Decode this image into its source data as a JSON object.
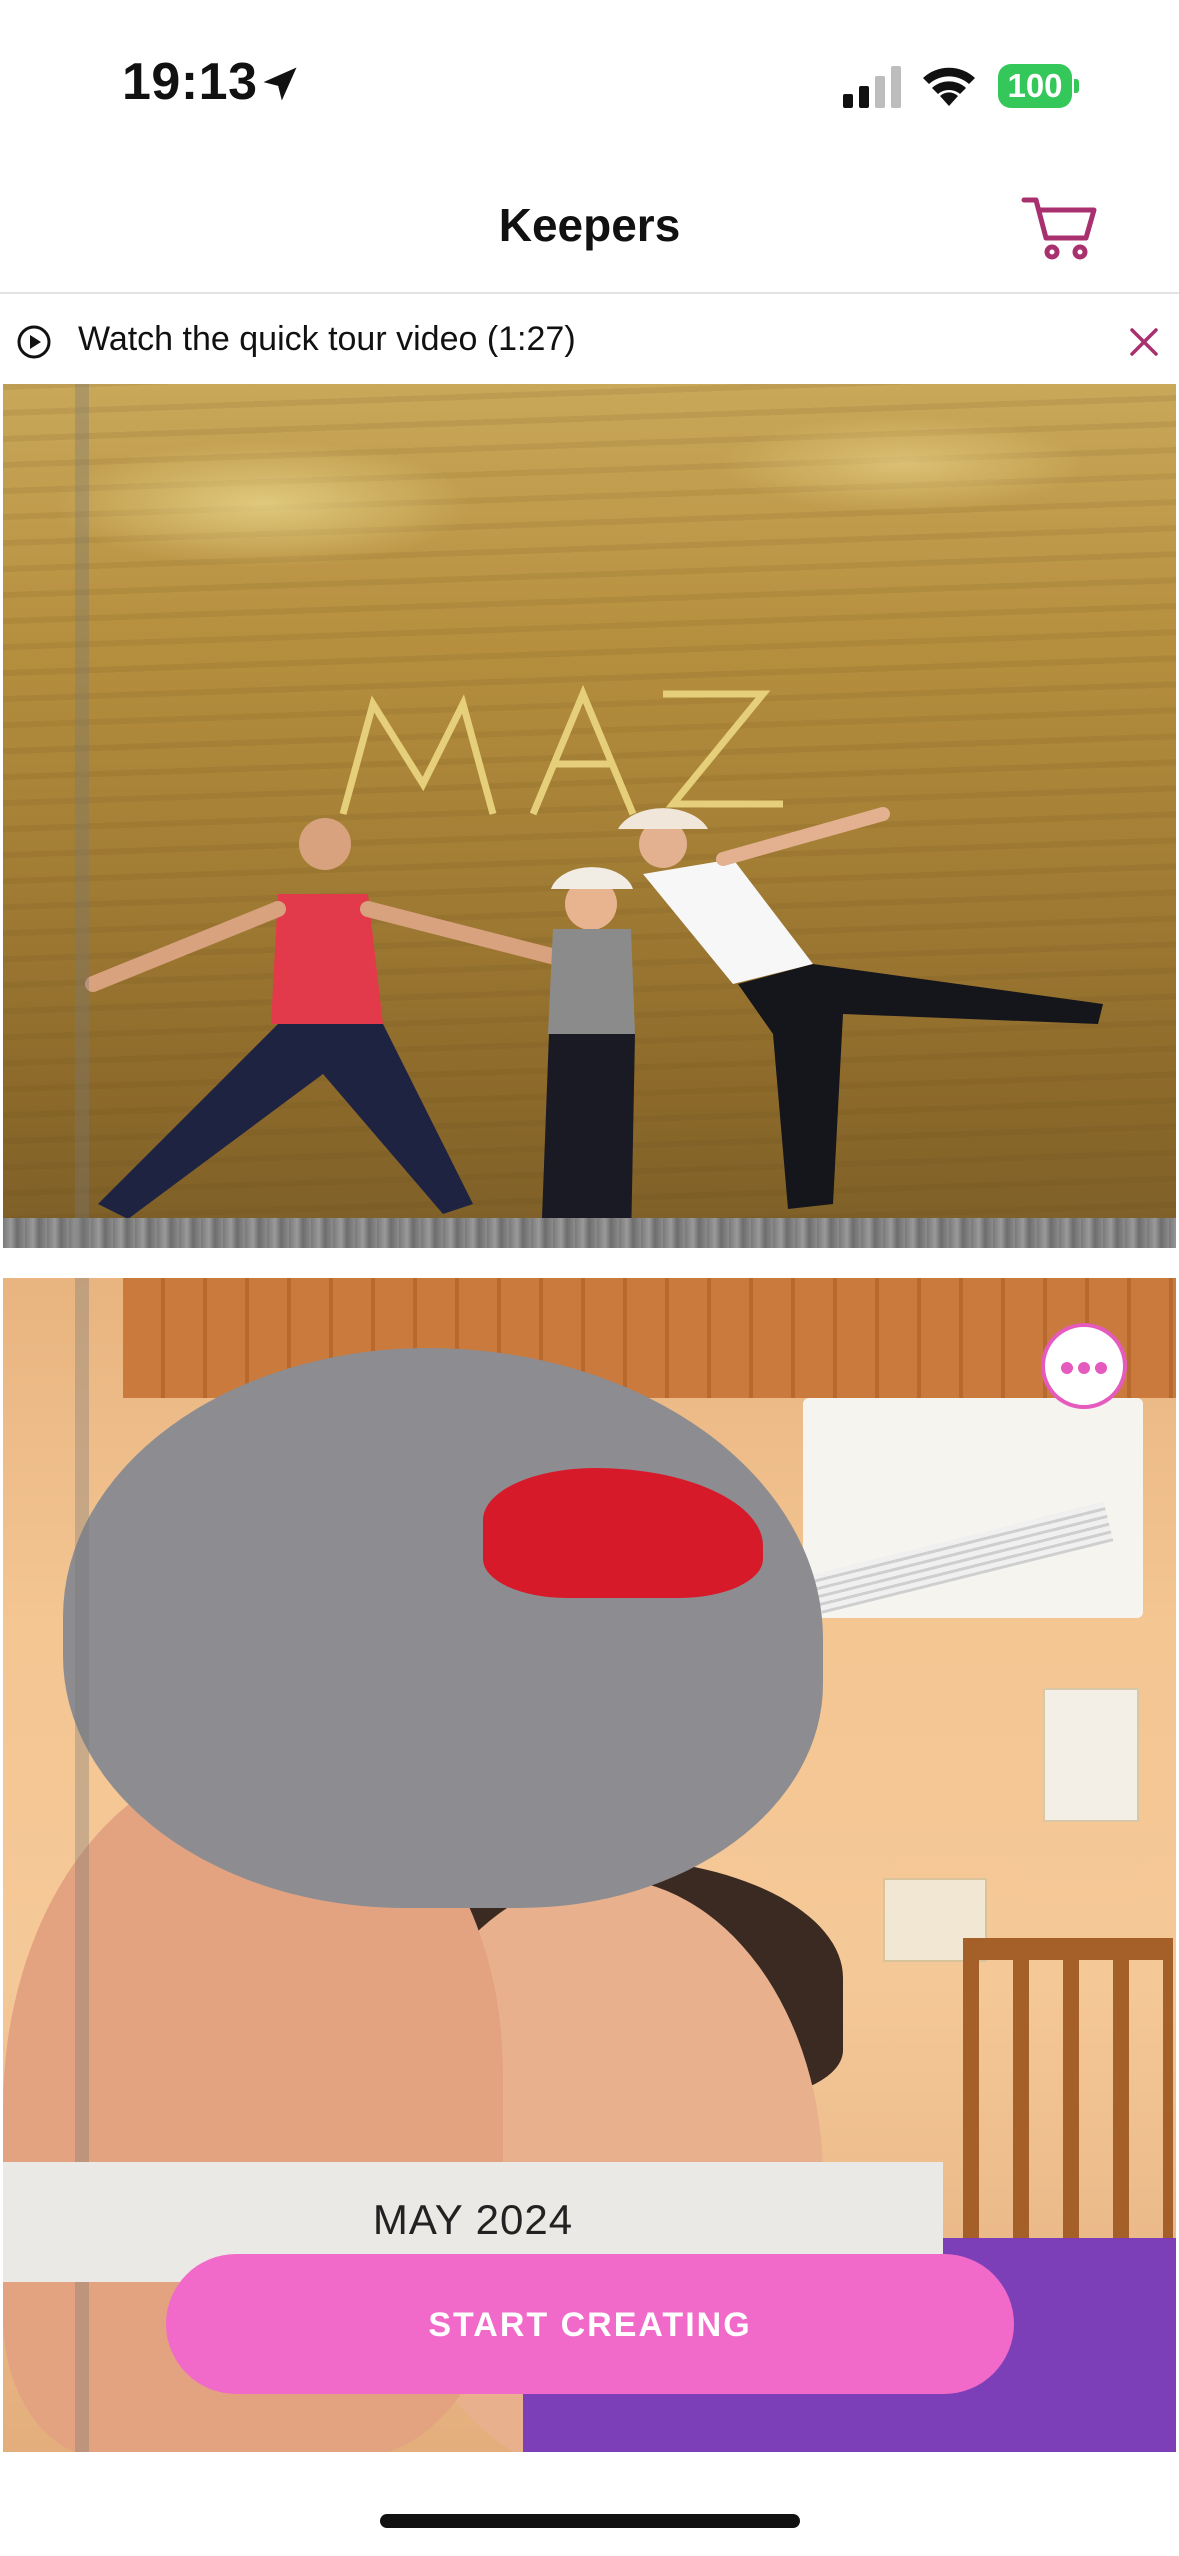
{
  "status_bar": {
    "time": "19:13",
    "battery": "100"
  },
  "nav": {
    "title": "Keepers",
    "cart_icon": "shopping-cart-icon"
  },
  "tour_banner": {
    "text": "Watch the quick tour video (1:27)"
  },
  "photo_card": {
    "date_label": "MAY 2024"
  },
  "cta": {
    "label": "START CREATING"
  },
  "colors": {
    "accent": "#e55bbd",
    "cta_bg": "#f26ac9",
    "cart_icon": "#a8306e",
    "battery": "#34c759"
  }
}
